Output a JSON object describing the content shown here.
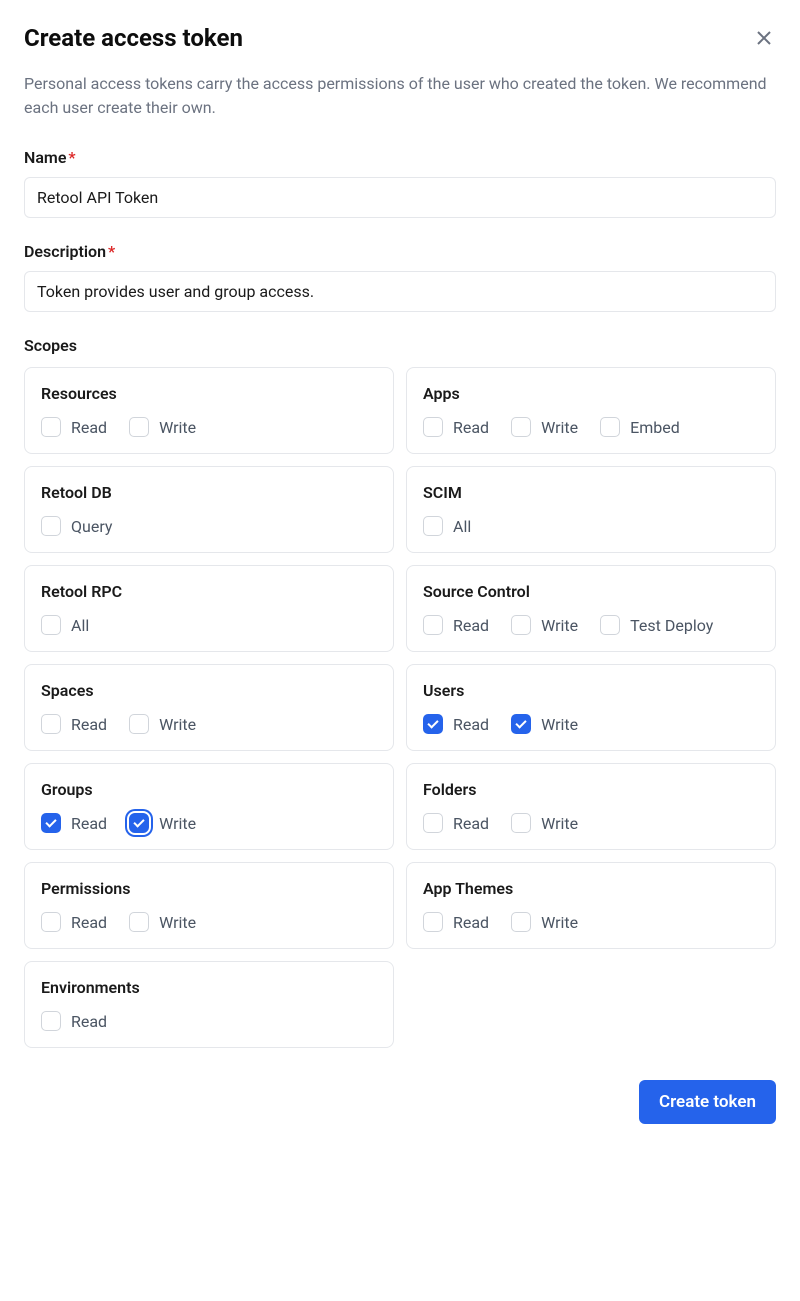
{
  "header": {
    "title": "Create access token"
  },
  "description": "Personal access tokens carry the access permissions of the user who created the token. We recommend each user create their own.",
  "fields": {
    "name": {
      "label": "Name",
      "value": "Retool API Token"
    },
    "description": {
      "label": "Description",
      "value": "Token provides user and group access."
    }
  },
  "scopes": {
    "label": "Scopes",
    "resources": {
      "title": "Resources",
      "read": "Read",
      "write": "Write"
    },
    "apps": {
      "title": "Apps",
      "read": "Read",
      "write": "Write",
      "embed": "Embed"
    },
    "retooldb": {
      "title": "Retool DB",
      "query": "Query"
    },
    "scim": {
      "title": "SCIM",
      "all": "All"
    },
    "retoolrpc": {
      "title": "Retool RPC",
      "all": "All"
    },
    "sourcecontrol": {
      "title": "Source Control",
      "read": "Read",
      "write": "Write",
      "testdeploy": "Test Deploy"
    },
    "spaces": {
      "title": "Spaces",
      "read": "Read",
      "write": "Write"
    },
    "users": {
      "title": "Users",
      "read": "Read",
      "write": "Write"
    },
    "groups": {
      "title": "Groups",
      "read": "Read",
      "write": "Write"
    },
    "folders": {
      "title": "Folders",
      "read": "Read",
      "write": "Write"
    },
    "permissions": {
      "title": "Permissions",
      "read": "Read",
      "write": "Write"
    },
    "appthemes": {
      "title": "App Themes",
      "read": "Read",
      "write": "Write"
    },
    "environments": {
      "title": "Environments",
      "read": "Read"
    }
  },
  "footer": {
    "submit": "Create token"
  }
}
